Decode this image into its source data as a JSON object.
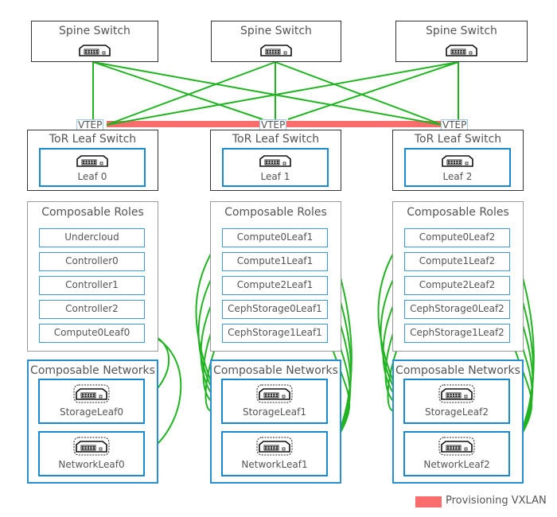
{
  "colors": {
    "link": "#22b322",
    "vxlan": "#f86c6c",
    "network_border": "#1a88cc"
  },
  "spines": [
    {
      "title": "Spine Switch",
      "icon": "switch-icon"
    },
    {
      "title": "Spine Switch",
      "icon": "switch-icon"
    },
    {
      "title": "Spine Switch",
      "icon": "switch-icon"
    }
  ],
  "leaves": [
    {
      "vtep": "VTEP",
      "title": "ToR Leaf Switch",
      "switch": "Leaf 0",
      "roles_title": "Composable Roles",
      "roles": [
        "Undercloud",
        "Controller0",
        "Controller1",
        "Controller2",
        "Compute0Leaf0"
      ],
      "networks_title": "Composable Networks",
      "networks": [
        "StorageLeaf0",
        "NetworkLeaf0"
      ]
    },
    {
      "vtep": "VTEP",
      "title": "ToR Leaf Switch",
      "switch": "Leaf 1",
      "roles_title": "Composable Roles",
      "roles": [
        "Compute0Leaf1",
        "Compute1Leaf1",
        "Compute2Leaf1",
        "CephStorage0Leaf1",
        "CephStorage1Leaf1"
      ],
      "networks_title": "Composable Networks",
      "networks": [
        "StorageLeaf1",
        "NetworkLeaf1"
      ]
    },
    {
      "vtep": "VTEP",
      "title": "ToR Leaf Switch",
      "switch": "Leaf 2",
      "roles_title": "Composable Roles",
      "roles": [
        "Compute0Leaf2",
        "Compute1Leaf2",
        "Compute2Leaf2",
        "CephStorage0Leaf2",
        "CephStorage1Leaf2"
      ],
      "networks_title": "Composable Networks",
      "networks": [
        "StorageLeaf2",
        "NetworkLeaf2"
      ]
    }
  ],
  "legend": {
    "label": "Provisioning VXLAN"
  }
}
